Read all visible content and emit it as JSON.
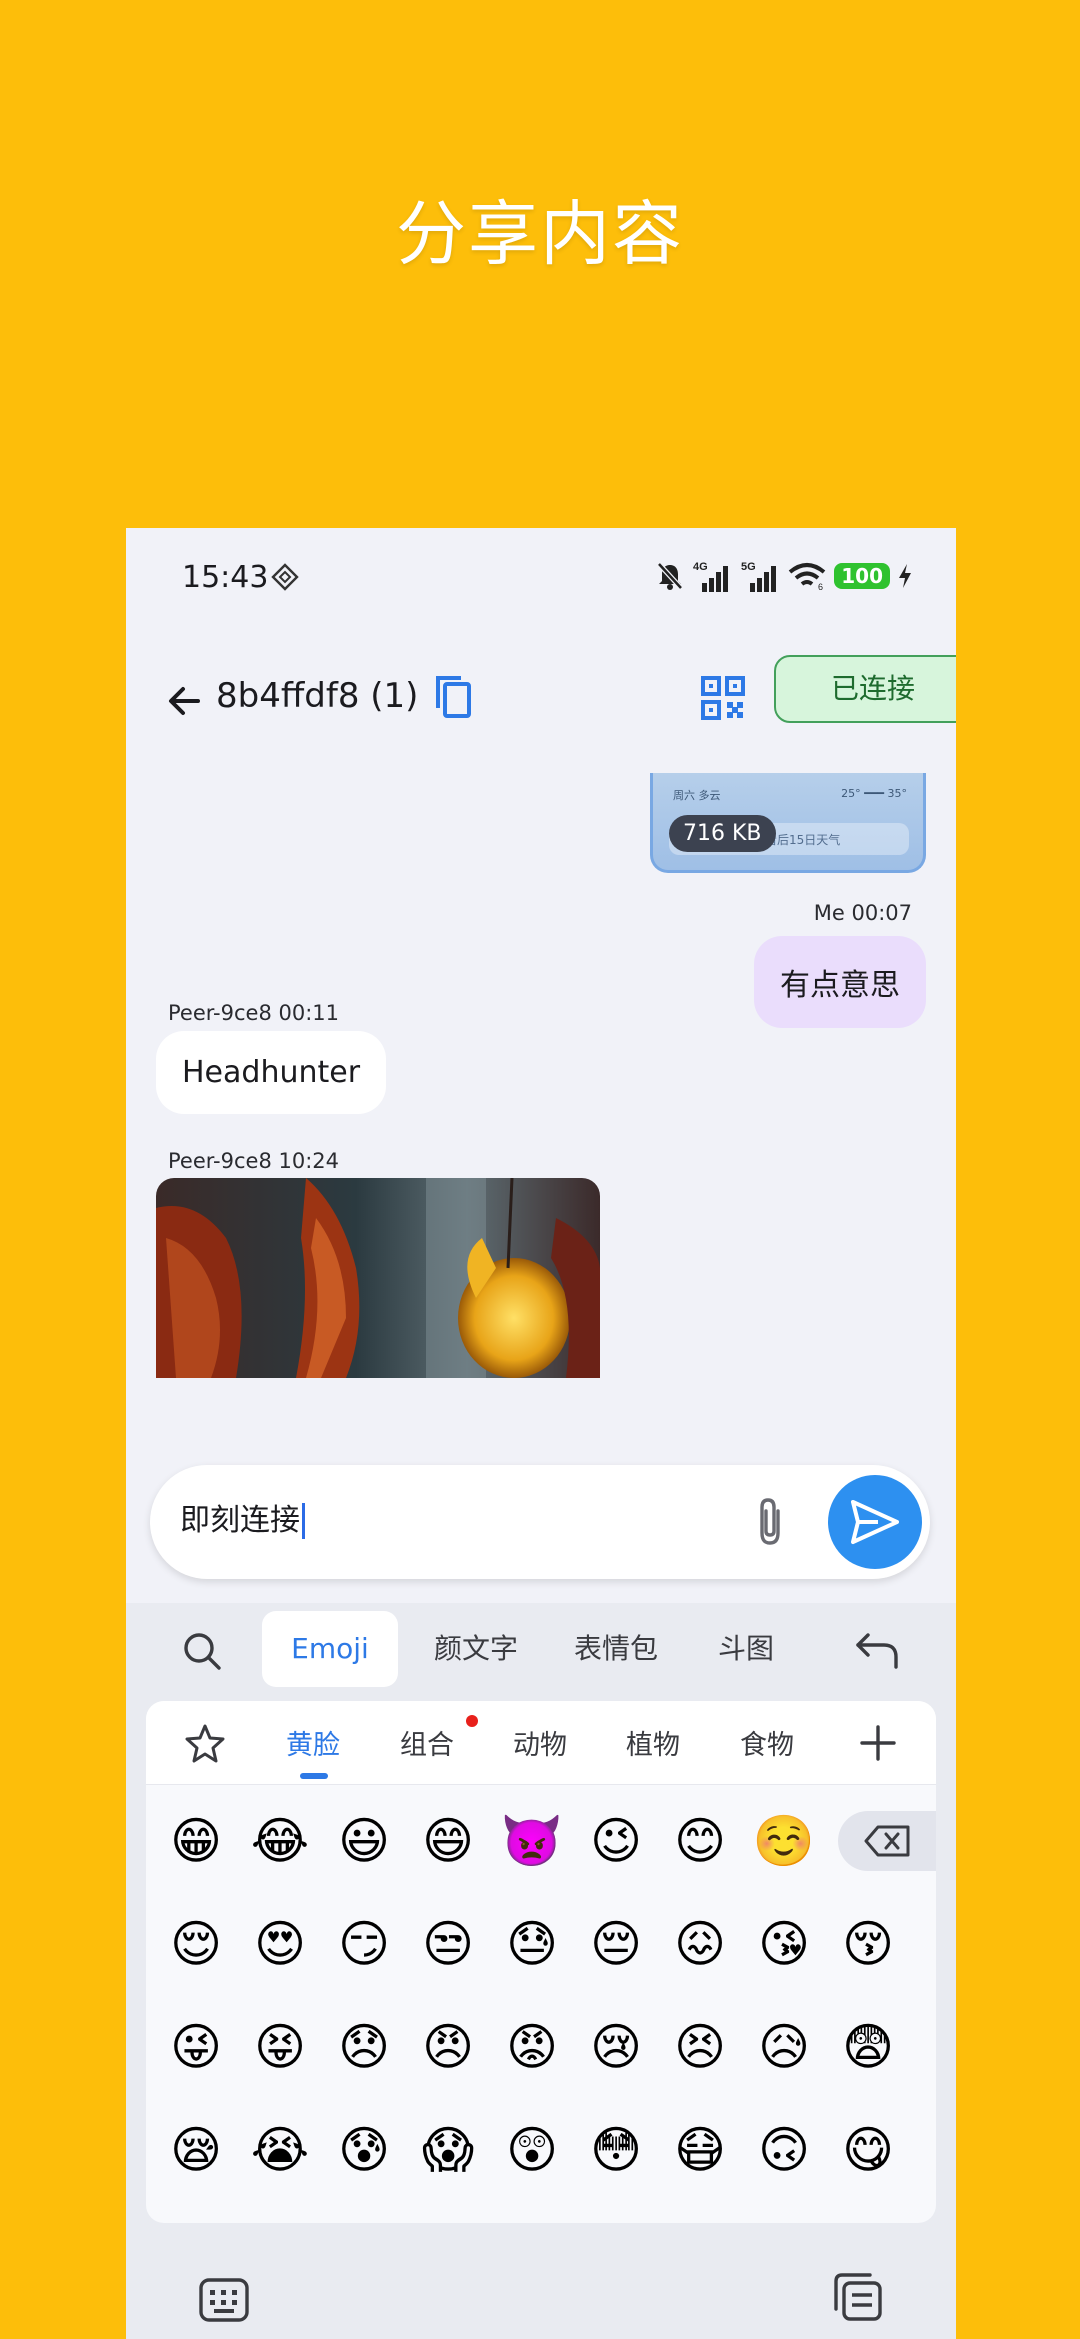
{
  "hero": {
    "title": "分享内容"
  },
  "status_bar": {
    "time": "15:43",
    "network_4g": "4G",
    "network_5g": "5G",
    "wifi_sub": "6",
    "battery": "100"
  },
  "app_bar": {
    "title": "8b4ffdf8 (1)",
    "connection_button": "已连接"
  },
  "messages": {
    "file_card": {
      "size": "716 KB",
      "weather_day": "周六  多云",
      "weather_temp": "25°  ━━━  35°",
      "weather_bar": "看后15日天气"
    },
    "me_meta": "Me   00:07",
    "me_text": "有点意思",
    "peer1_meta": "Peer-9ce8   00:11",
    "peer1_text": "Headhunter",
    "peer2_meta": "Peer-9ce8   10:24"
  },
  "composer": {
    "value": "即刻连接"
  },
  "keyboard": {
    "tabs": [
      "Emoji",
      "颜文字",
      "表情包",
      "斗图"
    ],
    "categories": [
      "黄脸",
      "组合",
      "动物",
      "植物",
      "食物"
    ],
    "emoji_rows": [
      [
        "😁",
        "😂",
        "😃",
        "😄",
        "👿",
        "😉",
        "😊",
        "☺️"
      ],
      [
        "😌",
        "😍",
        "😏",
        "😒",
        "😓",
        "😔",
        "😖",
        "😘",
        "😚"
      ],
      [
        "😜",
        "😝",
        "😞",
        "😠",
        "😡",
        "😢",
        "😣",
        "😥",
        "😨"
      ],
      [
        "😪",
        "😭",
        "😰",
        "😱",
        "😲",
        "😳",
        "😷",
        "🙃",
        "😋"
      ]
    ]
  }
}
